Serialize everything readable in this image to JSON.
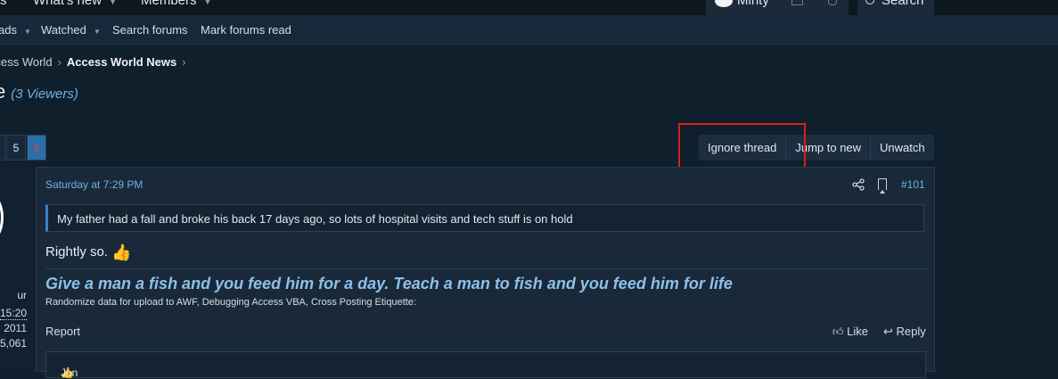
{
  "topnav": {
    "tabs": [
      "s",
      "What's new",
      "Members"
    ],
    "user": "Minty",
    "search_label": "Search"
  },
  "subnav": {
    "items": [
      "ads",
      "Watched",
      "Search forums",
      "Mark forums read"
    ]
  },
  "breadcrumb": {
    "items": [
      "ccess World",
      "Access World News"
    ]
  },
  "thread": {
    "title_fragment": "e",
    "viewers": "(3 Viewers)"
  },
  "pagination": {
    "pages": [
      "5",
      "6"
    ],
    "current": "6"
  },
  "thread_actions": {
    "ignore": "Ignore thread",
    "jump": "Jump to new",
    "unwatch": "Unwatch"
  },
  "user_stats": [
    "ur",
    "15:20",
    "2011",
    "5,061"
  ],
  "post": {
    "date": "Saturday at 7:29 PM",
    "number": "#101",
    "quote": "My father had a fall and broke his back 17 days ago, so lots of hospital visits and tech stuff is on hold",
    "body": "Rightly so.",
    "signature_title": "Give a man a fish and you feed him for a day. Teach a man to fish and you feed him for life",
    "signature_links": "Randomize data for upload to AWF, Debugging Access VBA, Cross Posting Etiquette:",
    "report": "Report",
    "like": "Like",
    "reply": "Reply",
    "reaction_user": "Jon"
  },
  "icons": [
    "chevron-down-icon",
    "chevron-right-icon",
    "share-icon",
    "bookmark-icon",
    "thumbs-up-icon",
    "reply-icon",
    "search-icon",
    "bell-icon",
    "inbox-icon"
  ],
  "colors": {
    "background": "#101f2c",
    "accent": "#6fb1e0",
    "highlight": "#e01b1b",
    "current_page": "#2a6fa8"
  }
}
